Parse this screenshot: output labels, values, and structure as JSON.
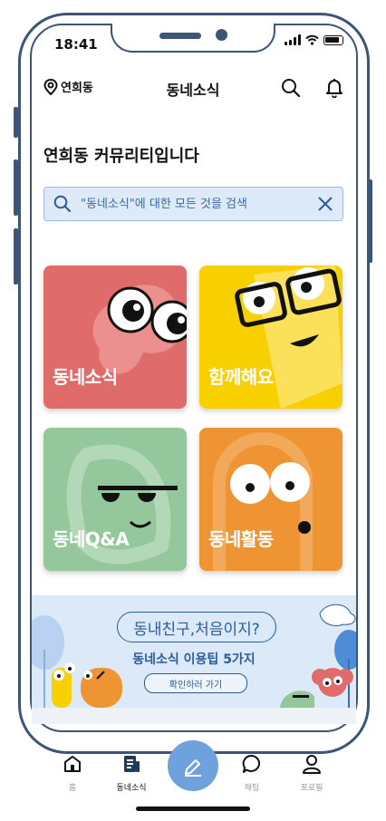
{
  "status": {
    "time": "18:41"
  },
  "header": {
    "location": "연희동",
    "title": "동네소식"
  },
  "page_title": "연희동 커뮤리티입니다",
  "search": {
    "placeholder": "\"동네소식\"에 대한 모든 것을 검색"
  },
  "cards": [
    {
      "label": "동네소식",
      "color": "#e06b6b"
    },
    {
      "label": "함께해요",
      "color": "#f8d000"
    },
    {
      "label": "동네Q&A",
      "color": "#94c79b"
    },
    {
      "label": "동네활동",
      "color": "#ee9433"
    }
  ],
  "banner": {
    "title": "동내친구,처음이지?",
    "subtitle": "동네소식 이용팁 5가지",
    "button": "확인하러 가기"
  },
  "tabs": [
    {
      "label": "홈",
      "icon": "home-icon"
    },
    {
      "label": "동네소식",
      "icon": "news-icon",
      "active": true
    },
    {
      "label": "채팅",
      "icon": "chat-icon"
    },
    {
      "label": "포로필",
      "icon": "profile-icon"
    }
  ],
  "fab": {
    "icon": "pencil-icon"
  },
  "colors": {
    "accent": "#6fa2dc",
    "frame": "#3d5577",
    "banner_text": "#2c5c9a"
  }
}
